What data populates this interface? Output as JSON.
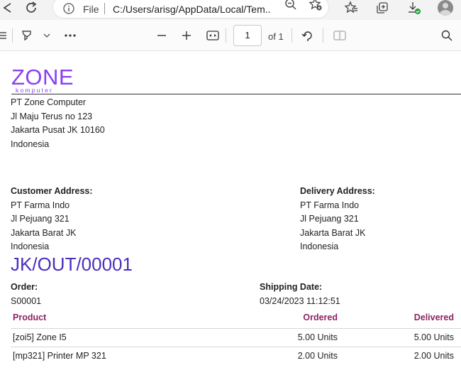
{
  "browser": {
    "address_scheme": "File",
    "address_url": "C:/Users/arisg/AppData/Local/Tem..."
  },
  "pdf_toolbar": {
    "page_current": "1",
    "page_total_label": "of 1"
  },
  "document": {
    "logo": {
      "main": "ZONE",
      "sub": "komputer"
    },
    "company": [
      "PT Zone Computer",
      "Jl Maju Terus no 123",
      "Jakarta Pusat JK 10160",
      "Indonesia"
    ],
    "customer": {
      "title": "Customer Address:",
      "lines": [
        "PT Farma Indo",
        "Jl Pejuang 321",
        "Jakarta Barat JK",
        "Indonesia"
      ]
    },
    "delivery": {
      "title": "Delivery Address:",
      "lines": [
        "PT Farma Indo",
        "Jl Pejuang 321",
        "Jakarta Barat JK",
        "Indonesia"
      ]
    },
    "doc_number": "JK/OUT/00001",
    "order": {
      "label": "Order:",
      "value": "S00001"
    },
    "shipping": {
      "label": "Shipping Date:",
      "value": "03/24/2023 11:12:51"
    },
    "table": {
      "headers": {
        "product": "Product",
        "ordered": "Ordered",
        "delivered": "Delivered"
      },
      "rows": [
        {
          "product": "[zoi5] Zone I5",
          "ordered": "5.00 Units",
          "delivered": "5.00 Units"
        },
        {
          "product": "[mp321] Printer MP 321",
          "ordered": "2.00 Units",
          "delivered": "2.00 Units"
        }
      ]
    }
  },
  "colors": {
    "logo": "#8b3ff0",
    "doc_number": "#4b2fbe",
    "table_header": "#8e2364"
  }
}
